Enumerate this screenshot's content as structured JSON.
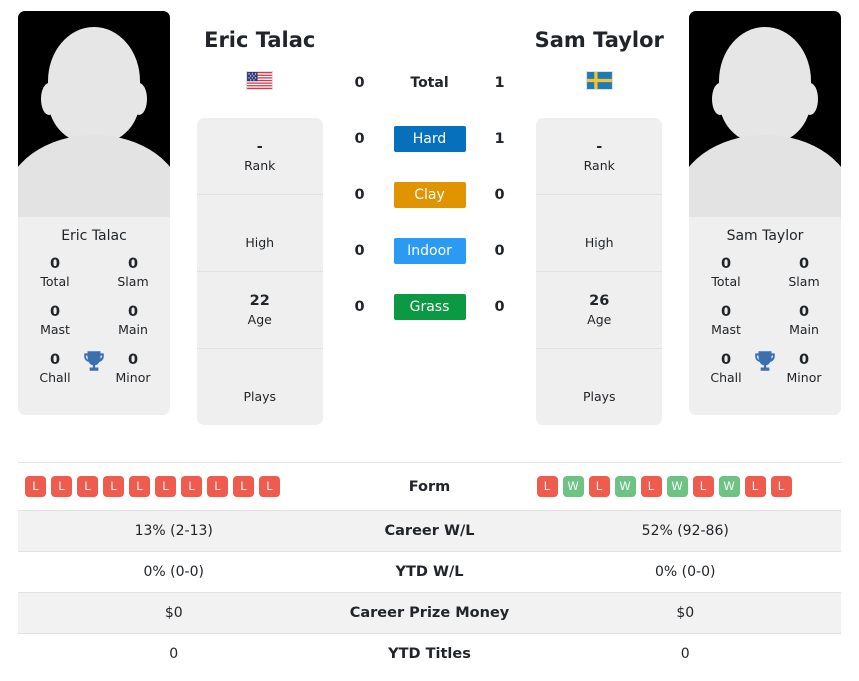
{
  "players": {
    "left": {
      "name": "Eric Talac",
      "country_flag": "us-flag-icon",
      "card_name": "Eric Talac",
      "titles": {
        "total": {
          "value": "0",
          "label": "Total"
        },
        "slam": {
          "value": "0",
          "label": "Slam"
        },
        "mast": {
          "value": "0",
          "label": "Mast"
        },
        "main": {
          "value": "0",
          "label": "Main"
        },
        "chall": {
          "value": "0",
          "label": "Chall"
        },
        "minor": {
          "value": "0",
          "label": "Minor"
        }
      },
      "info": [
        {
          "value": "-",
          "label": "Rank"
        },
        {
          "value": "",
          "label": "High"
        },
        {
          "value": "22",
          "label": "Age"
        },
        {
          "value": "",
          "label": "Plays"
        }
      ],
      "form": [
        "L",
        "L",
        "L",
        "L",
        "L",
        "L",
        "L",
        "L",
        "L",
        "L"
      ],
      "career_wl": "13% (2-13)",
      "ytd_wl": "0% (0-0)",
      "career_prize_money": "$0",
      "ytd_titles": "0"
    },
    "right": {
      "name": "Sam Taylor",
      "country_flag": "sweden-flag-icon",
      "card_name": "Sam Taylor",
      "titles": {
        "total": {
          "value": "0",
          "label": "Total"
        },
        "slam": {
          "value": "0",
          "label": "Slam"
        },
        "mast": {
          "value": "0",
          "label": "Mast"
        },
        "main": {
          "value": "0",
          "label": "Main"
        },
        "chall": {
          "value": "0",
          "label": "Chall"
        },
        "minor": {
          "value": "0",
          "label": "Minor"
        }
      },
      "info": [
        {
          "value": "-",
          "label": "Rank"
        },
        {
          "value": "",
          "label": "High"
        },
        {
          "value": "26",
          "label": "Age"
        },
        {
          "value": "",
          "label": "Plays"
        }
      ],
      "form": [
        "L",
        "W",
        "L",
        "W",
        "L",
        "W",
        "L",
        "W",
        "L",
        "L"
      ],
      "career_wl": "52% (92-86)",
      "ytd_wl": "0% (0-0)",
      "career_prize_money": "$0",
      "ytd_titles": "0"
    }
  },
  "head_to_head": [
    {
      "id": "total",
      "label": "Total",
      "left": "0",
      "right": "1",
      "color": "",
      "plain": true
    },
    {
      "id": "hard",
      "label": "Hard",
      "left": "0",
      "right": "1",
      "color": "#0670bd",
      "plain": false
    },
    {
      "id": "clay",
      "label": "Clay",
      "left": "0",
      "right": "0",
      "color": "#e09400",
      "plain": false
    },
    {
      "id": "indoor",
      "label": "Indoor",
      "left": "0",
      "right": "0",
      "color": "#2b9af3",
      "plain": false
    },
    {
      "id": "grass",
      "label": "Grass",
      "left": "0",
      "right": "0",
      "color": "#0c9944",
      "plain": false
    }
  ],
  "stat_rows": [
    {
      "id": "form",
      "label": "Form",
      "type": "form"
    },
    {
      "id": "career_wl",
      "label": "Career W/L",
      "type": "text",
      "shaded": true
    },
    {
      "id": "ytd_wl",
      "label": "YTD W/L",
      "type": "text",
      "shaded": false
    },
    {
      "id": "career_prize_money",
      "label": "Career Prize Money",
      "type": "text",
      "shaded": true
    },
    {
      "id": "ytd_titles",
      "label": "YTD Titles",
      "type": "text",
      "shaded": false
    }
  ],
  "colors": {
    "win_badge": "#ef5b4c",
    "loss_badge": "#ef5b4c",
    "win": "#6cc384",
    "loss": "#ef5b4c",
    "trophy": "#3a6fb0",
    "card_bg": "#efefef",
    "row_shade": "#f2f2f2"
  },
  "icons": {
    "trophy": "trophy-icon"
  }
}
